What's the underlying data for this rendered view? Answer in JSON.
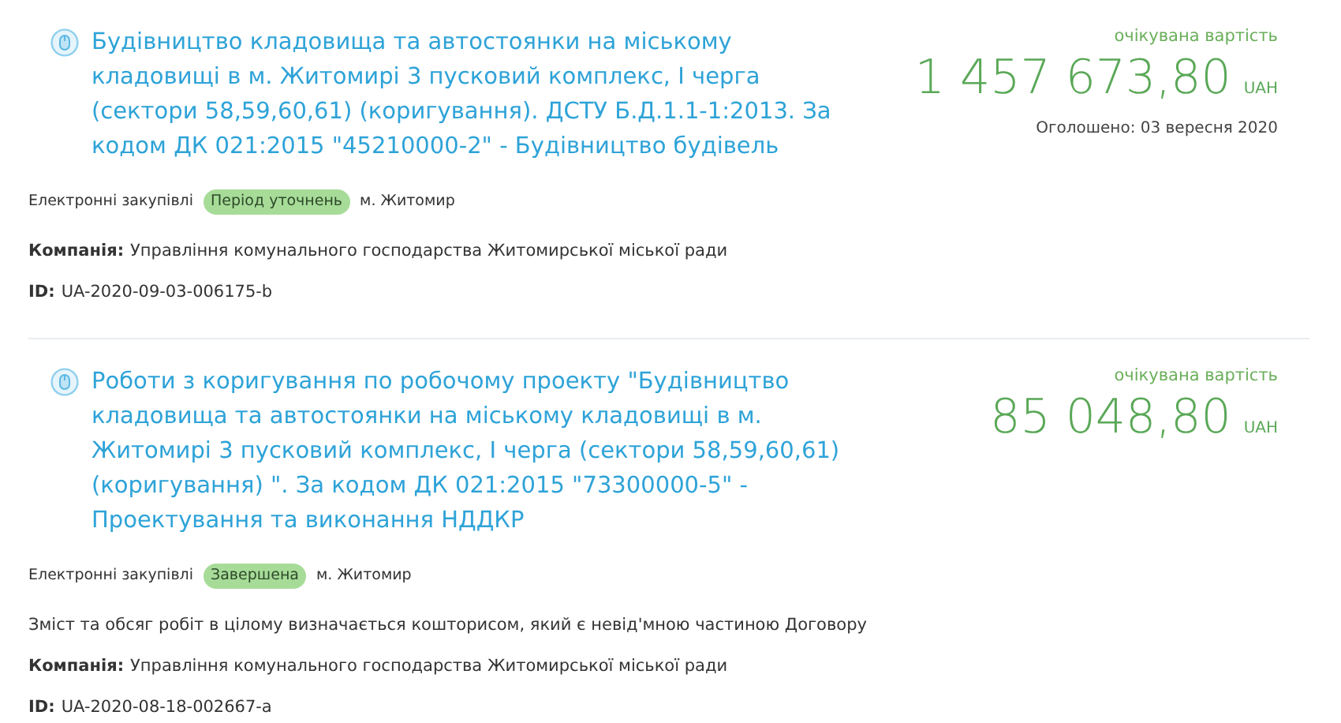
{
  "tenders": [
    {
      "title": "Будівництво кладовища та автостоянки на міському кладовищі в м. Житомирі 3 пусковий комплекс, І черга (сектори 58,59,60,61) (коригування). ДСТУ Б.Д.1.1-1:2013. За кодом ДК 021:2015 \"45210000-2\" - Будівництво будівель",
      "procurement_type": "Електронні закупівлі",
      "status": "Період уточнень",
      "city": "м. Житомир",
      "company_label": "Компанія:",
      "company": "Управління комунального господарства Житомирської міської ради",
      "id_label": "ID:",
      "id": "UA-2020-09-03-006175-b",
      "price_label": "очікувана вартість",
      "price": "1 457 673,80",
      "currency": "UAH",
      "announced": "Оголошено: 03 вересня 2020"
    },
    {
      "title": "Роботи з коригування по робочому проекту \"Будівництво кладовища та автостоянки на міському кладовищі в м. Житомирі 3 пусковий комплекс, І черга (сектори 58,59,60,61) (коригування) \". За кодом ДК 021:2015 \"73300000-5\" - Проектування та виконання НДДКР",
      "procurement_type": "Електронні закупівлі",
      "status": "Завершена",
      "city": "м. Житомир",
      "description": "Зміст та обсяг робіт в цілому визначається кошторисом, який є невід'мною частиною Договору",
      "company_label": "Компанія:",
      "company": "Управління комунального господарства Житомирської міської ради",
      "id_label": "ID:",
      "id": "UA-2020-08-18-002667-a",
      "price_label": "очікувана вартість",
      "price": "85 048,80",
      "currency": "UAH"
    }
  ]
}
